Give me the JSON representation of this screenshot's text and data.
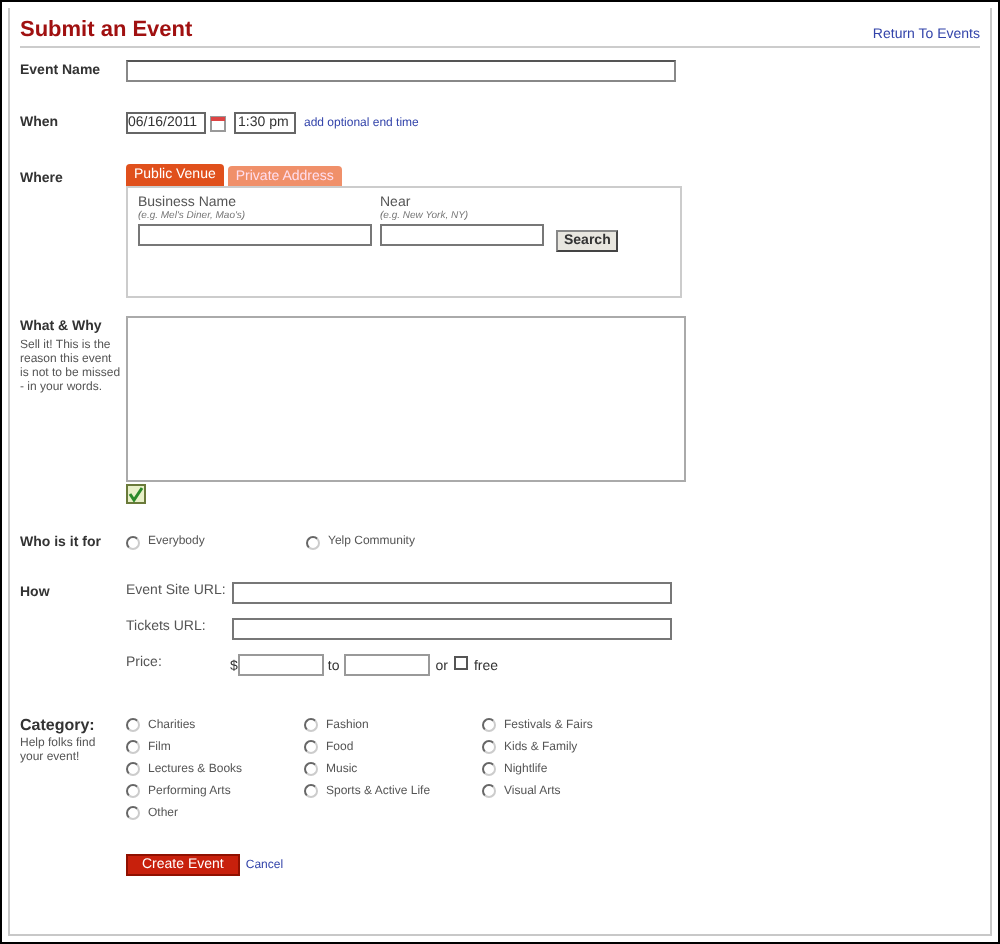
{
  "header": {
    "title": "Submit an Event",
    "return_link": "Return To Events"
  },
  "event_name": {
    "label": "Event Name"
  },
  "when": {
    "label": "When",
    "date": "06/16/2011",
    "time": "1:30 pm",
    "end_time_link": "add optional end time"
  },
  "where": {
    "label": "Where",
    "tabs": [
      {
        "label": "Public Venue",
        "selected": true
      },
      {
        "label": "Private Address",
        "selected": false
      }
    ],
    "business_name": {
      "label": "Business Name",
      "hint": "(e.g. Mel's Diner, Mao's)"
    },
    "near": {
      "label": "Near",
      "hint": "(e.g. New York, NY)"
    },
    "search_button": "Search"
  },
  "what_why": {
    "label": "What & Why",
    "hint": "Sell it! This is the reason this event is not to be missed - in your words."
  },
  "who": {
    "label": "Who is it for",
    "options": [
      {
        "label": "Everybody",
        "selected": false
      },
      {
        "label": "Yelp Community",
        "selected": false
      }
    ]
  },
  "how": {
    "label": "How",
    "site_url_label": "Event Site URL:",
    "tickets_url_label": "Tickets URL:",
    "price_label": "Price:",
    "currency": "$",
    "to": "to",
    "or": "or",
    "free": {
      "label": "free",
      "checked": false
    }
  },
  "category": {
    "label": "Category:",
    "hint": "Help folks find your event!",
    "options": [
      {
        "label": "Charities",
        "selected": false
      },
      {
        "label": "Fashion",
        "selected": false
      },
      {
        "label": "Festivals & Fairs",
        "selected": false
      },
      {
        "label": "Film",
        "selected": false
      },
      {
        "label": "Food",
        "selected": false
      },
      {
        "label": "Kids & Family",
        "selected": false
      },
      {
        "label": "Lectures & Books",
        "selected": false
      },
      {
        "label": "Music",
        "selected": false
      },
      {
        "label": "Nightlife",
        "selected": false
      },
      {
        "label": "Performing Arts",
        "selected": false
      },
      {
        "label": "Sports & Active Life",
        "selected": false
      },
      {
        "label": "Visual Arts",
        "selected": false
      },
      {
        "label": "Other",
        "selected": false
      }
    ]
  },
  "buttons": {
    "create": "Create Event",
    "cancel": "Cancel"
  }
}
